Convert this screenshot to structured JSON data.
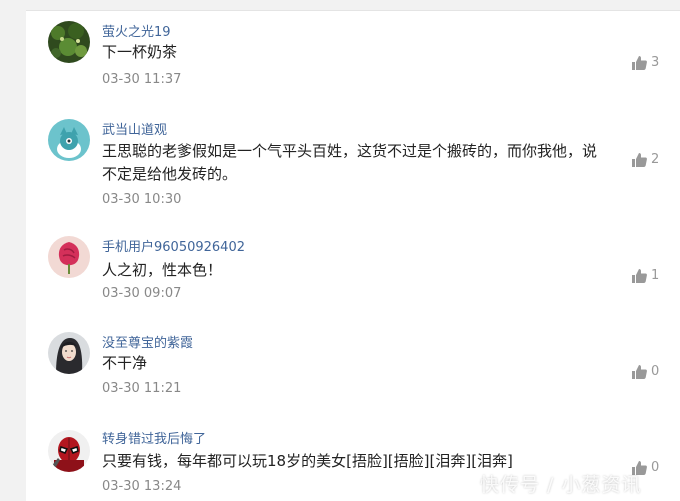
{
  "comments": [
    {
      "username": "萤火之光19",
      "text": "下一杯奶茶",
      "time": "03-30 11:37",
      "likes": "3",
      "avatar": "nature-photo-avatar"
    },
    {
      "username": "武当山道观",
      "text": "王思聪的老爹假如是一个气平头百姓，这货不过是个搬砖的，而你我他，说不定是给他发砖的。",
      "time": "03-30 10:30",
      "likes": "2",
      "avatar": "teal-cartoon-avatar"
    },
    {
      "username": "手机用户96050926402",
      "text": "人之初，性本色！",
      "time": "03-30 09:07",
      "likes": "1",
      "avatar": "pink-flower-avatar"
    },
    {
      "username": "没至尊宝的紫霞",
      "text": "不干净",
      "time": "03-30 11:21",
      "likes": "0",
      "avatar": "portrait-photo-avatar"
    },
    {
      "username": "转身错过我后悔了",
      "text": "只要有钱，每年都可以玩18岁的美女[捂脸][捂脸][泪奔][泪奔]",
      "time": "03-30 13:24",
      "likes": "0",
      "avatar": "superhero-avatar"
    }
  ],
  "watermark": "快传号 / 小葱资讯"
}
